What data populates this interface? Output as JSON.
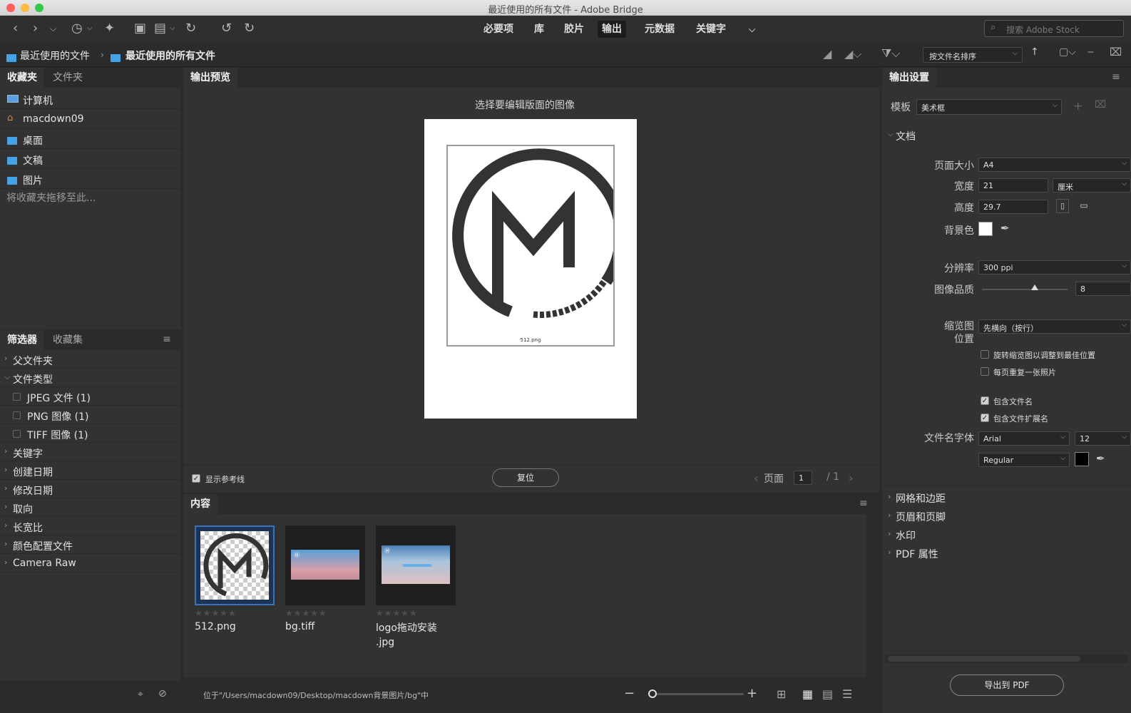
{
  "window": {
    "title": "最近使用的所有文件 - Adobe Bridge"
  },
  "toolbar": {
    "workspaces": [
      "必要项",
      "库",
      "胶片",
      "输出",
      "元数据",
      "关键字"
    ],
    "search_placeholder": "搜索 Adobe Stock"
  },
  "pathbar": {
    "crumbs": [
      "最近使用的文件",
      "最近使用的所有文件"
    ],
    "sort_label": "按文件名排序"
  },
  "left": {
    "tabs_top": [
      "收藏夹",
      "文件夹"
    ],
    "favorites": [
      "计算机",
      "macdown09",
      "桌面",
      "文稿",
      "图片"
    ],
    "drag_hint": "将收藏夹拖移至此...",
    "tabs_bottom": [
      "筛选器",
      "收藏集"
    ],
    "filters": [
      {
        "label": "父文件夹",
        "expanded": false
      },
      {
        "label": "文件类型",
        "expanded": true
      },
      {
        "label": "关键字",
        "expanded": false
      },
      {
        "label": "创建日期",
        "expanded": false
      },
      {
        "label": "修改日期",
        "expanded": false
      },
      {
        "label": "取向",
        "expanded": false
      },
      {
        "label": "长宽比",
        "expanded": false
      },
      {
        "label": "颜色配置文件",
        "expanded": false
      },
      {
        "label": "Camera Raw",
        "expanded": false
      }
    ],
    "file_types": [
      "JPEG 文件 (1)",
      "PNG 图像 (1)",
      "TIFF 图像 (1)"
    ]
  },
  "preview": {
    "tab": "输出预览",
    "heading": "选择要编辑版面的图像",
    "image_caption": "512.png",
    "show_guides": "显示参考线",
    "reset_button": "复位",
    "page_label": "页面",
    "page_value": "1",
    "page_total": "/ 1"
  },
  "content": {
    "tab": "内容",
    "items": [
      {
        "name": "512.png",
        "selected": true
      },
      {
        "name": "bg.tiff",
        "selected": false
      },
      {
        "name": "logo拖动安装\n.jpg",
        "selected": false
      }
    ],
    "status": "位于\"/Users/macdown09/Desktop/macdown背景图片/bg\"中"
  },
  "output": {
    "tab": "输出设置",
    "template_label": "模板",
    "template_value": "美术框",
    "document_section": "文档",
    "page_size_label": "页面大小",
    "page_size_value": "A4",
    "width_label": "宽度",
    "width_value": "21",
    "unit_value": "厘米",
    "height_label": "高度",
    "height_value": "29.7",
    "bg_label": "背景色",
    "resolution_label": "分辨率",
    "resolution_value": "300 ppi",
    "quality_label": "图像品质",
    "quality_value": "8",
    "quality_level": 0.62,
    "thumb_pos_label_1": "缩览图",
    "thumb_pos_label_2": "位置",
    "thumb_pos_value": "先横向（按行）",
    "opt_rotate": "旋转缩览图以调整到最佳位置",
    "opt_repeat": "每页重复一张照片",
    "opt_include_name": "包含文件名",
    "opt_include_ext": "包含文件扩展名",
    "font_label": "文件名字体",
    "font_value": "Arial",
    "font_size_value": "12",
    "font_style_value": "Regular",
    "sections": [
      "网格和边距",
      "页眉和页脚",
      "水印",
      "PDF 属性"
    ],
    "export_button": "导出到 PDF"
  },
  "colors": {
    "accent": "#44a3e6",
    "selection": "#3b73b9",
    "bg_dark": "#2b2b2b",
    "panel": "#323232"
  }
}
